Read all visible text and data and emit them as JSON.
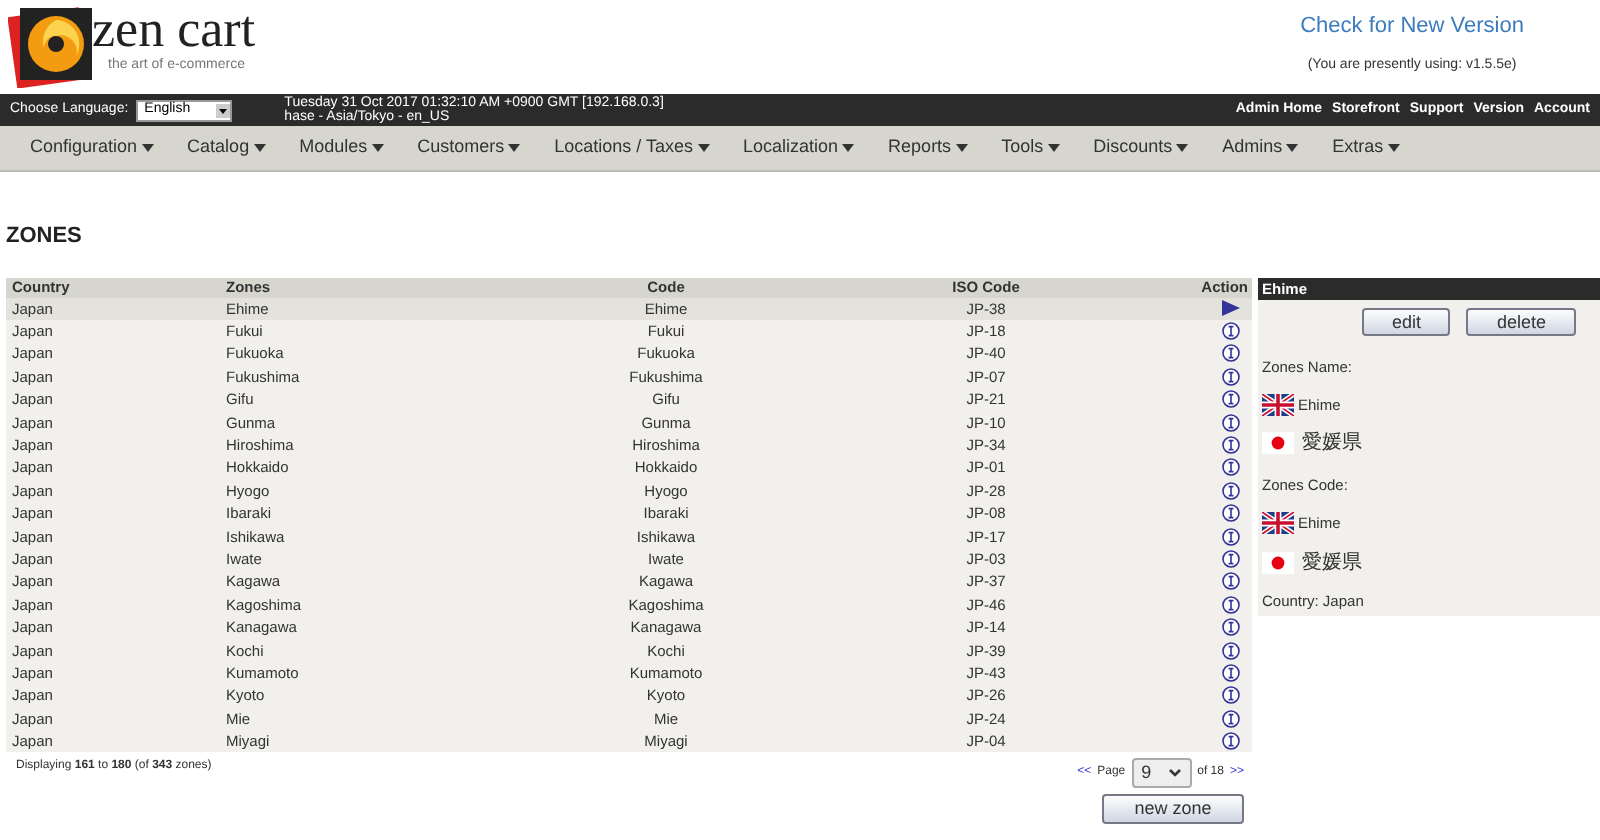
{
  "header": {
    "logo_name": "zen cart",
    "logo_tagline": "the art of e-commerce",
    "version_link": "Check for New Version",
    "version_note": "(You are presently using: v1.5.5e)"
  },
  "top_bar": {
    "language_label": "Choose Language:",
    "language": "English",
    "info_line_1": "Tuesday 31 Oct 2017 01:32:10 AM +0900 GMT [192.168.0.3]",
    "info_line_2": "hase - Asia/Tokyo - en_US",
    "links": [
      "Admin Home",
      "Storefront",
      "Support",
      "Version",
      "Account"
    ]
  },
  "menu": [
    "Configuration",
    "Catalog",
    "Modules",
    "Customers",
    "Locations / Taxes",
    "Localization",
    "Reports",
    "Tools",
    "Discounts",
    "Admins",
    "Extras"
  ],
  "page_title": "ZONES",
  "table": {
    "columns": [
      "Country",
      "Zones",
      "Code",
      "ISO Code",
      "Action"
    ],
    "rows": [
      {
        "country": "Japan",
        "zone": "Ehime",
        "code": "Ehime",
        "iso": "JP-38",
        "selected": true
      },
      {
        "country": "Japan",
        "zone": "Fukui",
        "code": "Fukui",
        "iso": "JP-18",
        "selected": false
      },
      {
        "country": "Japan",
        "zone": "Fukuoka",
        "code": "Fukuoka",
        "iso": "JP-40",
        "selected": false
      },
      {
        "country": "Japan",
        "zone": "Fukushima",
        "code": "Fukushima",
        "iso": "JP-07",
        "selected": false
      },
      {
        "country": "Japan",
        "zone": "Gifu",
        "code": "Gifu",
        "iso": "JP-21",
        "selected": false
      },
      {
        "country": "Japan",
        "zone": "Gunma",
        "code": "Gunma",
        "iso": "JP-10",
        "selected": false
      },
      {
        "country": "Japan",
        "zone": "Hiroshima",
        "code": "Hiroshima",
        "iso": "JP-34",
        "selected": false
      },
      {
        "country": "Japan",
        "zone": "Hokkaido",
        "code": "Hokkaido",
        "iso": "JP-01",
        "selected": false
      },
      {
        "country": "Japan",
        "zone": "Hyogo",
        "code": "Hyogo",
        "iso": "JP-28",
        "selected": false
      },
      {
        "country": "Japan",
        "zone": "Ibaraki",
        "code": "Ibaraki",
        "iso": "JP-08",
        "selected": false
      },
      {
        "country": "Japan",
        "zone": "Ishikawa",
        "code": "Ishikawa",
        "iso": "JP-17",
        "selected": false
      },
      {
        "country": "Japan",
        "zone": "Iwate",
        "code": "Iwate",
        "iso": "JP-03",
        "selected": false
      },
      {
        "country": "Japan",
        "zone": "Kagawa",
        "code": "Kagawa",
        "iso": "JP-37",
        "selected": false
      },
      {
        "country": "Japan",
        "zone": "Kagoshima",
        "code": "Kagoshima",
        "iso": "JP-46",
        "selected": false
      },
      {
        "country": "Japan",
        "zone": "Kanagawa",
        "code": "Kanagawa",
        "iso": "JP-14",
        "selected": false
      },
      {
        "country": "Japan",
        "zone": "Kochi",
        "code": "Kochi",
        "iso": "JP-39",
        "selected": false
      },
      {
        "country": "Japan",
        "zone": "Kumamoto",
        "code": "Kumamoto",
        "iso": "JP-43",
        "selected": false
      },
      {
        "country": "Japan",
        "zone": "Kyoto",
        "code": "Kyoto",
        "iso": "JP-26",
        "selected": false
      },
      {
        "country": "Japan",
        "zone": "Mie",
        "code": "Mie",
        "iso": "JP-24",
        "selected": false
      },
      {
        "country": "Japan",
        "zone": "Miyagi",
        "code": "Miyagi",
        "iso": "JP-04",
        "selected": false
      }
    ]
  },
  "footer": {
    "summary": "Displaying **161** to **180** (of **343** zones)",
    "prev": "<<",
    "page_label": "Page",
    "page": "9",
    "of_pages": "of 18",
    "next": ">>",
    "new_button": "new zone"
  },
  "side_panel": {
    "title": "Ehime",
    "buttons": [
      "edit",
      "delete"
    ],
    "sections": [
      {
        "label": "Zones Name:",
        "entries": [
          {
            "kind": "uk",
            "text": "Ehime"
          },
          {
            "kind": "jp",
            "text": "愛媛県"
          }
        ]
      },
      {
        "label": "Zones Code:",
        "entries": [
          {
            "kind": "uk",
            "text": "Ehime"
          },
          {
            "kind": "jp",
            "text": "愛媛県"
          }
        ]
      }
    ],
    "country": "Country: Japan"
  }
}
